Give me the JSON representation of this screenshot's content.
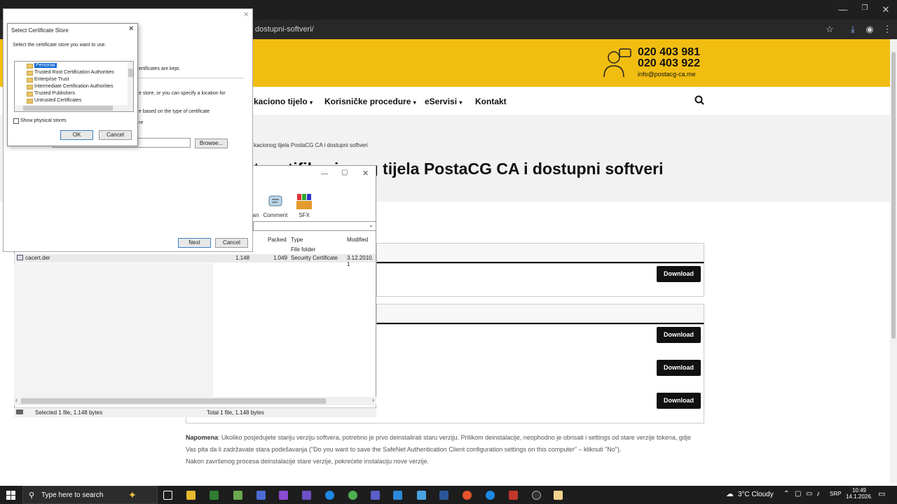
{
  "browser": {
    "url_fragment": "dostupni-softveri/",
    "icons": [
      "bookmark-star-icon",
      "download-icon",
      "profile-icon",
      "kebab-menu-icon"
    ],
    "window_controls": [
      "—",
      "❐",
      "✕"
    ]
  },
  "site": {
    "phone1": "020 403 981",
    "phone2": "020 403 922",
    "email": "info@postacg-ca.me",
    "nav": [
      "kaciono tijelo",
      "Korisničke procedure",
      "eServisi",
      "Kontakt"
    ],
    "breadcrumb": "kacionog tijela PostaCG CA i dostupni softveri",
    "title": "t sertifikacionog tijela PostaCG CA i dostupni softveri",
    "download_label": "Download",
    "note_bold": "Napomena",
    "note_text": ": Ukoliko posjedujete stariju verziju softvera, potrebno je prvo deinstalirati staru verziju. Prilikom deinstalacije, neophodno je obrisati i settings od stare verzije tokena, gdje Vas pita da li zadržavate stara podešavanja (\"Do you want to save the SafeNet Authentication Client configuration settings on this computer\" – kliknuti \"No\").",
    "note_text2": "Nakon završenog procesa deinstalacije stare verzije, pokrećete instalaciju nove verzije."
  },
  "winrar": {
    "toolbar": [
      "an",
      "Comment",
      "SFX"
    ],
    "columns": [
      "Packed",
      "Type",
      "Modified"
    ],
    "folder_row_type": "File folder",
    "file": {
      "name": "cacert.der",
      "size": "1.148",
      "packed": "1.049",
      "type": "Security Certificate",
      "modified": "3.12.2010. 1"
    },
    "status_left": "Selected 1 file, 1.148 bytes",
    "status_right": "Total 1 file, 1.148 bytes"
  },
  "wizard": {
    "line1": "ertificates are kept.",
    "line2": "e store, or you can specify a location for",
    "line3": "e based on the type of certificate",
    "line4": "re",
    "browse_label": "Browse...",
    "next_label": "Next",
    "cancel_label": "Cancel"
  },
  "store_dialog": {
    "title": "Select Certificate Store",
    "instruction": "Select the certificate store you want to use.",
    "stores": [
      "Personal",
      "Trusted Root Certification Authorities",
      "Enterprise Trust",
      "Intermediate Certification Authorities",
      "Trusted Publishers",
      "Untrusted Certificates"
    ],
    "show_physical": "Show physical stores",
    "ok_label": "OK",
    "cancel_label": "Cancel"
  },
  "taskbar": {
    "search_placeholder": "Type here to search",
    "weather": "3°C  Cloudy",
    "lang": "SRP",
    "time": "10:49",
    "date": "14.1.2026."
  }
}
